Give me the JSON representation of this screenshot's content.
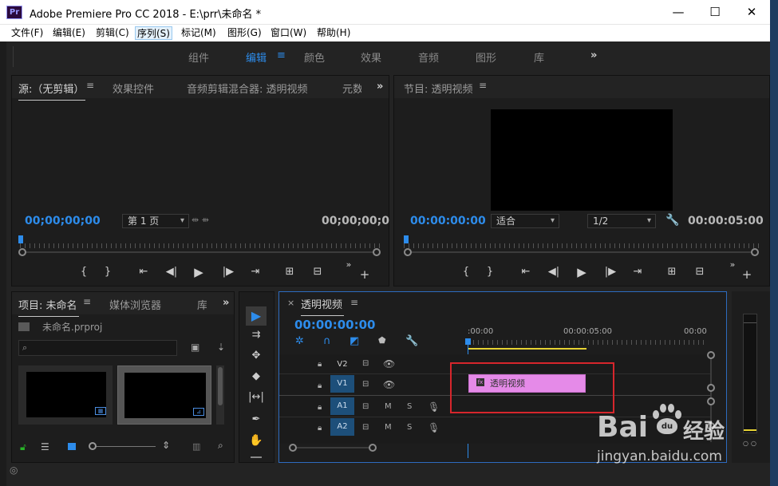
{
  "window": {
    "app_icon_label": "Pr",
    "title": "Adobe Premiere Pro CC 2018 - E:\\prr\\未命名 *",
    "minimize": "—",
    "maximize": "☐",
    "close": "✕"
  },
  "menubar": {
    "items": [
      "文件(F)",
      "编辑(E)",
      "剪辑(C)",
      "序列(S)",
      "标记(M)",
      "图形(G)",
      "窗口(W)",
      "帮助(H)"
    ],
    "active_index": 3
  },
  "workspaces": {
    "tabs": [
      "组件",
      "编辑",
      "颜色",
      "效果",
      "音频",
      "图形",
      "库"
    ],
    "active": "编辑",
    "more": "»"
  },
  "source_panel": {
    "tabs": [
      "源:（无剪辑）",
      "效果控件",
      "音频剪辑混合器: 透明视频",
      "元数"
    ],
    "timecode_left": "00;00;00;00",
    "page_select": "第 1 页",
    "timecode_right": "00;00;00;0"
  },
  "program_panel": {
    "tab": "节目: 透明视频",
    "timecode_left": "00:00:00:00",
    "fit_select": "适合",
    "quality_select": "1/2",
    "timecode_right": "00:00:05:00"
  },
  "project_panel": {
    "tabs": [
      "项目: 未命名",
      "媒体浏览器",
      "库"
    ],
    "project_file": "未命名.prproj"
  },
  "timeline": {
    "sequence_name": "透明视频",
    "close": "×",
    "timecode": "00:00:00:00",
    "ruler_labels": [
      ":00:00",
      "00:00:05:00",
      "00:00:"
    ],
    "tracks": [
      {
        "id": "V2",
        "type": "video"
      },
      {
        "id": "V1",
        "type": "video"
      },
      {
        "id": "A1",
        "type": "audio",
        "m": "M",
        "s": "S"
      },
      {
        "id": "A2",
        "type": "audio",
        "m": "M",
        "s": "S"
      }
    ],
    "clip_name": "透明视频",
    "clip_badge": "fx"
  },
  "watermark": {
    "brand": "Bai",
    "brand_suffix": "经验",
    "url": "jingyan.baidu.com"
  },
  "colors": {
    "accent": "#2d8ceb",
    "clip": "#e58ae8",
    "annotation": "#d6262c",
    "work_area": "#e6d233"
  }
}
